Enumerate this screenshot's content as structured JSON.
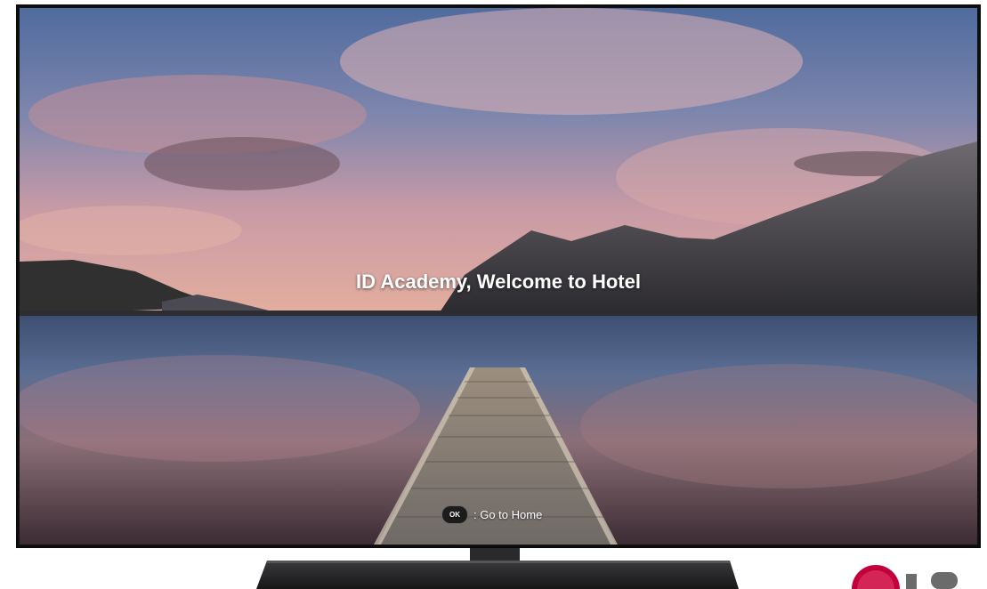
{
  "screen": {
    "welcome_text": "ID Academy, Welcome to Hotel",
    "hint": {
      "key_label": "OK",
      "action_text": ": Go to Home"
    }
  },
  "brand": {
    "logo": "LG",
    "logo_color": "#c4003c"
  }
}
